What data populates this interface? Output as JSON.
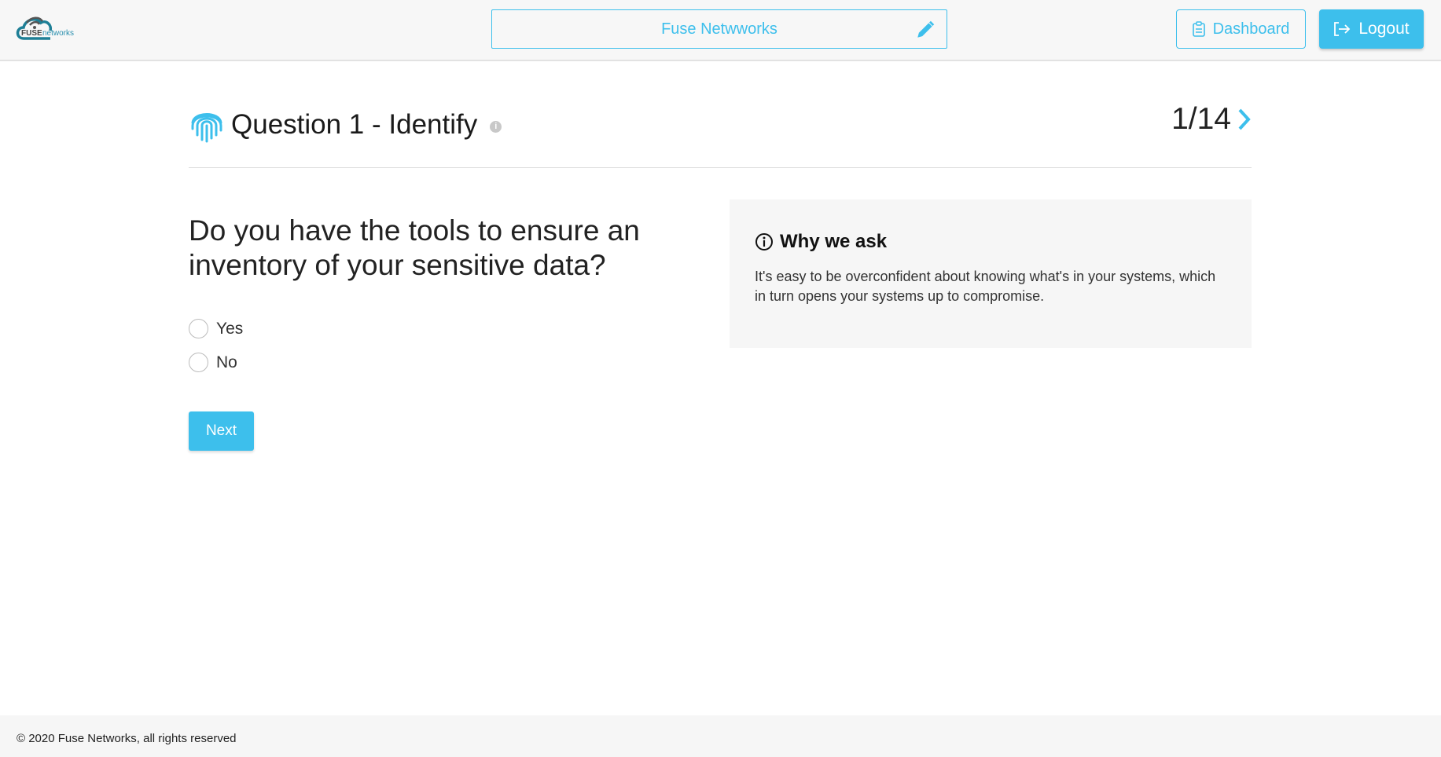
{
  "header": {
    "logo_text": "FUSE networks",
    "project_title": "Fuse Netwworks",
    "edit_icon": "pencil-icon",
    "dashboard_label": "Dashboard",
    "dashboard_icon": "clipboard-icon",
    "logout_label": "Logout",
    "logout_icon": "sign-out-icon"
  },
  "question": {
    "icon": "fingerprint-icon",
    "title": "Question 1 - Identify",
    "pager": "1/14",
    "text": "Do you have the tools to ensure an inventory of your sensitive data?",
    "options": [
      {
        "label": "Yes",
        "selected": false
      },
      {
        "label": "No",
        "selected": false
      }
    ],
    "next_label": "Next"
  },
  "why_panel": {
    "title": "Why we ask",
    "text": "It's easy to be overconfident about knowing what's in your systems, which in turn opens your systems up to compromise."
  },
  "footer": {
    "copyright": "© 2020 Fuse Networks, all rights reserved"
  },
  "colors": {
    "accent": "#3dbfec",
    "header_bg": "#f7f7f7",
    "panel_bg": "#f6f6f6"
  }
}
